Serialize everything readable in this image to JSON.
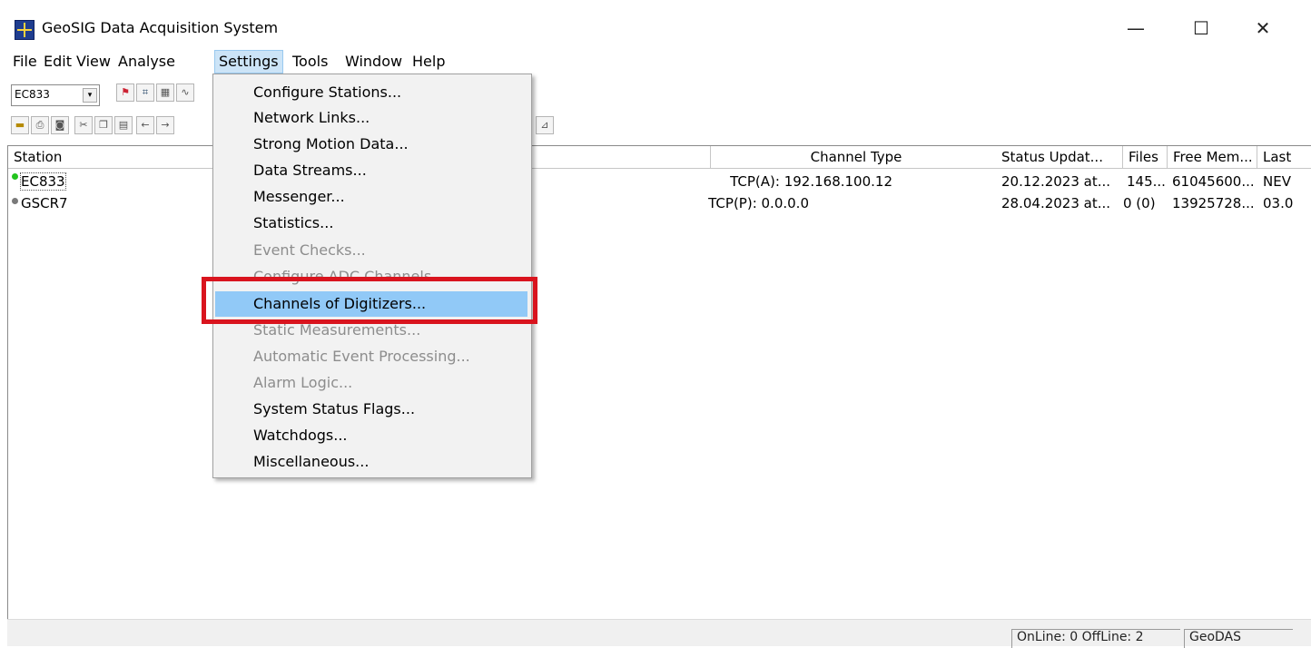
{
  "window": {
    "title": "GeoSIG Data Acquisition System",
    "controls": {
      "minimize": "—",
      "maximize": "☐",
      "close": "✕"
    }
  },
  "menubar": {
    "items": [
      "File",
      "Edit",
      "View",
      "Analyse",
      "Settings",
      "Tools",
      "Window",
      "Help"
    ],
    "active": "Settings"
  },
  "toolbar": {
    "station_select": "EC833",
    "dropdown_arrow": "▾"
  },
  "list": {
    "columns": [
      "Station",
      "Channel Type",
      "Status Updat...",
      "Files",
      "Free Mem...",
      "Last"
    ],
    "rows": [
      {
        "station": "EC833",
        "status_color": "#22c41e",
        "channel_type": "TCP(A): 192.168.100.12",
        "status_update": "20.12.2023 at...",
        "files": "145...",
        "free_mem": "61045600...",
        "last": "NEV"
      },
      {
        "station": "GSCR7",
        "status_color": "#7a7a7a",
        "channel_type": "TCP(P): 0.0.0.0",
        "status_update": "28.04.2023 at...",
        "files": "0 (0)",
        "free_mem": "13925728...",
        "last": "03.0"
      }
    ]
  },
  "settings_menu": {
    "items": [
      {
        "label": "Configure Stations...",
        "enabled": true
      },
      {
        "label": "Network Links...",
        "enabled": true
      },
      {
        "label": "Strong Motion Data...",
        "enabled": true
      },
      {
        "label": "Data Streams...",
        "enabled": true
      },
      {
        "label": "Messenger...",
        "enabled": true
      },
      {
        "label": "Statistics...",
        "enabled": true
      },
      {
        "label": "Event Checks...",
        "enabled": false
      },
      {
        "label": "Configure ADC Channels...",
        "enabled": false
      },
      {
        "label": "Channels of Digitizers...",
        "enabled": true,
        "highlighted": true
      },
      {
        "label": "Static Measurements...",
        "enabled": false
      },
      {
        "label": "Automatic Event Processing...",
        "enabled": false
      },
      {
        "label": "Alarm Logic...",
        "enabled": false
      },
      {
        "label": "System Status Flags...",
        "enabled": true
      },
      {
        "label": "Watchdogs...",
        "enabled": true
      },
      {
        "label": "Miscellaneous...",
        "enabled": true
      }
    ]
  },
  "statusbar": {
    "online_text": "OnLine: 0  OffLine: 2",
    "app_text": "GeoDAS"
  },
  "colors": {
    "highlight_box": "#d9141e",
    "menu_hover": "#91c9f7"
  }
}
